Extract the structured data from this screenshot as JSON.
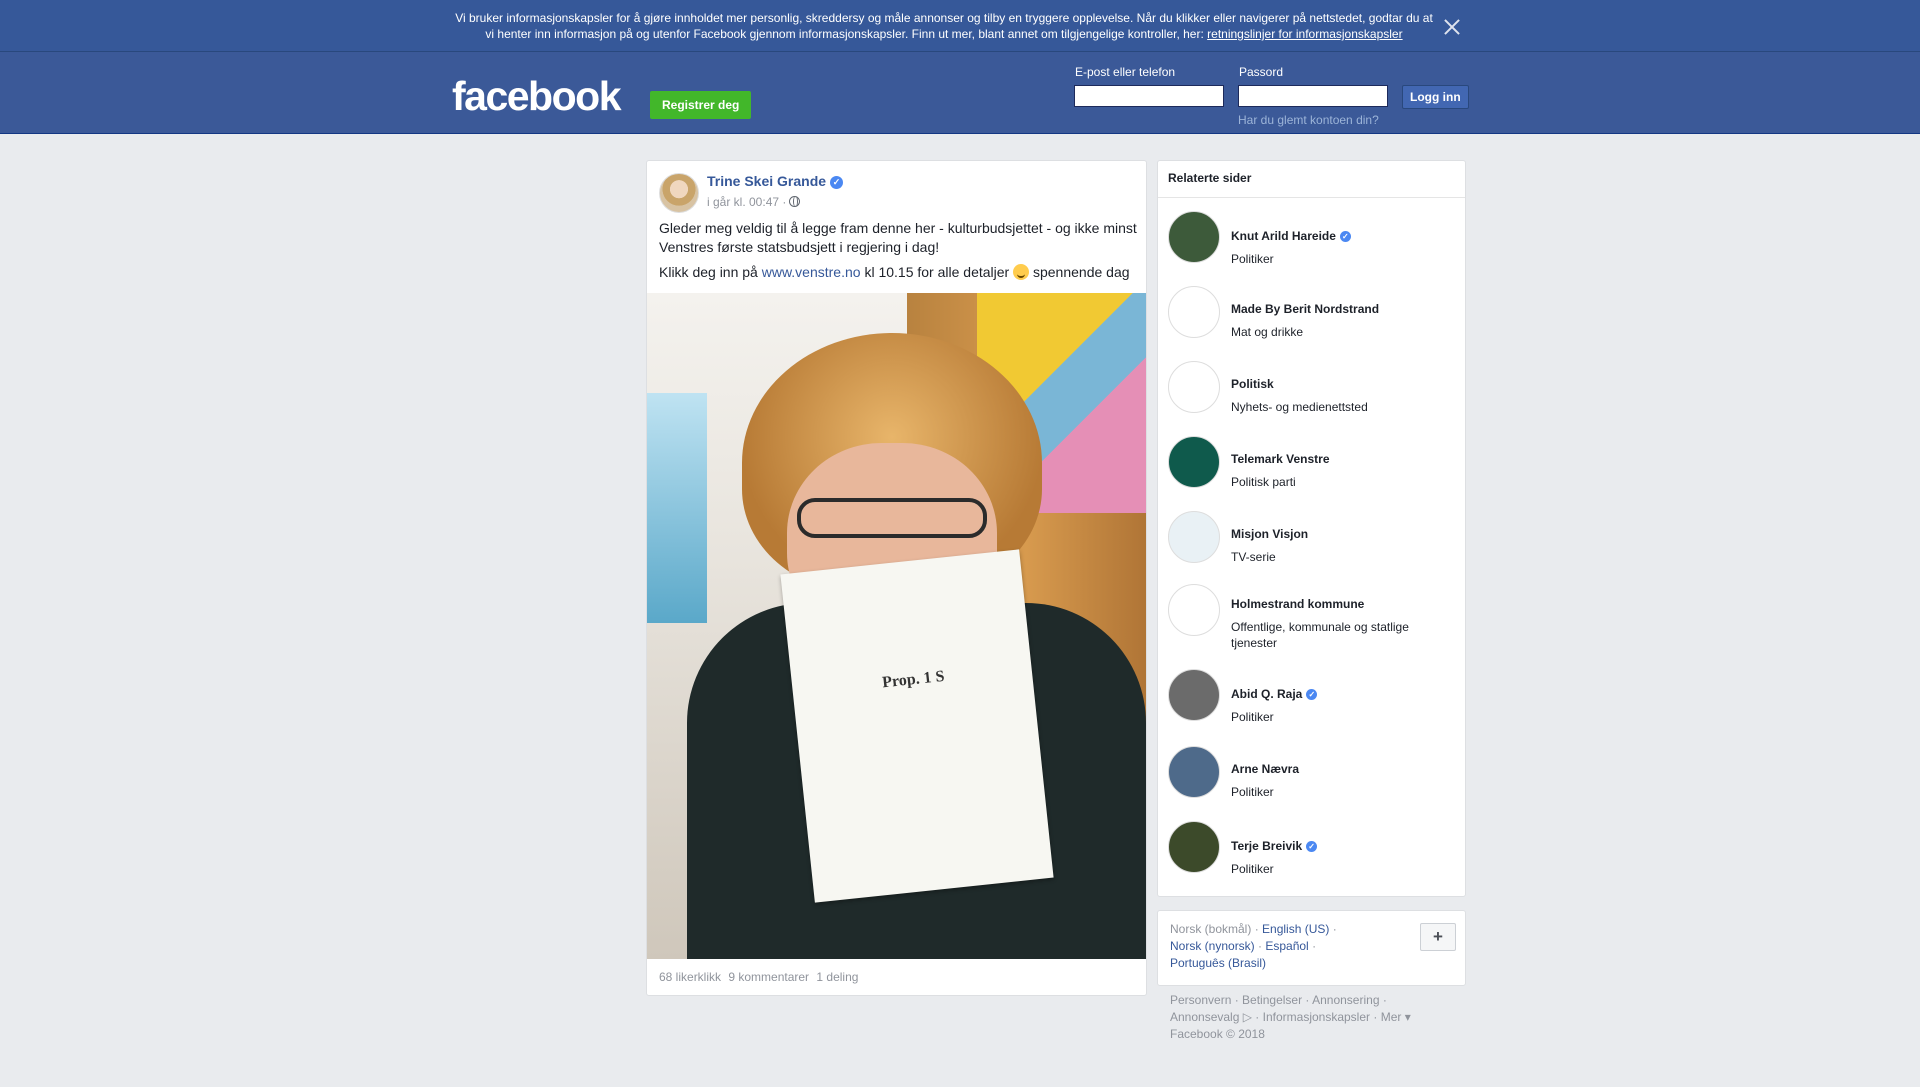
{
  "cookie": {
    "text": "Vi bruker informasjonskapsler for å gjøre innholdet mer personlig, skreddersy og måle annonser og tilby en tryggere opplevelse. Når du klikker eller navigerer på nettstedet, godtar du at vi henter inn informasjon på og utenfor Facebook gjennom informasjonskapsler. Finn ut mer, blant annet om tilgjengelige kontroller, her: ",
    "link": "retningslinjer for informasjonskapsler"
  },
  "header": {
    "logo": "facebook",
    "register": "Registrer deg",
    "email_label": "E-post eller telefon",
    "password_label": "Passord",
    "login": "Logg inn",
    "forgot": "Har du glemt kontoen din?"
  },
  "post": {
    "author": "Trine Skei Grande",
    "time": "i går kl. 00:47 ·",
    "text1": "Gleder meg veldig til å legge fram denne her - kulturbudsjettet - og ikke minst Venstres første statsbudsjett i regjering i dag!",
    "text2_pre": "Klikk deg inn på ",
    "text2_link": "www.venstre.no",
    "text2_post": " kl 10.15 for alle detaljer ",
    "text2_end": " spennende dag",
    "paper_title": "Prop. 1 S",
    "likes": "68 likerklikk",
    "comments": "9 kommentarer",
    "shares": "1 deling"
  },
  "related": {
    "title": "Relaterte sider",
    "items": [
      {
        "name": "Knut Arild Hareide",
        "category": "Politiker",
        "verified": true,
        "color": "#3d5a3a"
      },
      {
        "name": "Made By Berit Nordstrand",
        "category": "Mat og drikke",
        "verified": false,
        "color": "#ffffff"
      },
      {
        "name": "Politisk",
        "category": "Nyhets- og medienettsted",
        "verified": false,
        "color": "#ffffff"
      },
      {
        "name": "Telemark Venstre",
        "category": "Politisk parti",
        "verified": false,
        "color": "#0f5a4c"
      },
      {
        "name": "Misjon Visjon",
        "category": "TV-serie",
        "verified": false,
        "color": "#e9f1f5"
      },
      {
        "name": "Holmestrand kommune",
        "category": "Offentlige, kommunale og statlige tjenester",
        "verified": false,
        "color": "#ffffff"
      },
      {
        "name": "Abid Q. Raja",
        "category": "Politiker",
        "verified": true,
        "color": "#6b6b6b"
      },
      {
        "name": "Arne Nævra",
        "category": "Politiker",
        "verified": false,
        "color": "#4e6a8a"
      },
      {
        "name": "Terje Breivik",
        "category": "Politiker",
        "verified": true,
        "color": "#3c4a2a"
      }
    ]
  },
  "languages": {
    "current": "Norsk (bokmål)",
    "others": [
      "English (US)",
      "Norsk (nynorsk)",
      "Español",
      "Português (Brasil)"
    ],
    "more": "+"
  },
  "footer": {
    "links": [
      "Personvern",
      "Betingelser",
      "Annonsering",
      "Annonsevalg",
      "Informasjonskapsler",
      "Mer"
    ],
    "copyright": "Facebook © 2018"
  }
}
